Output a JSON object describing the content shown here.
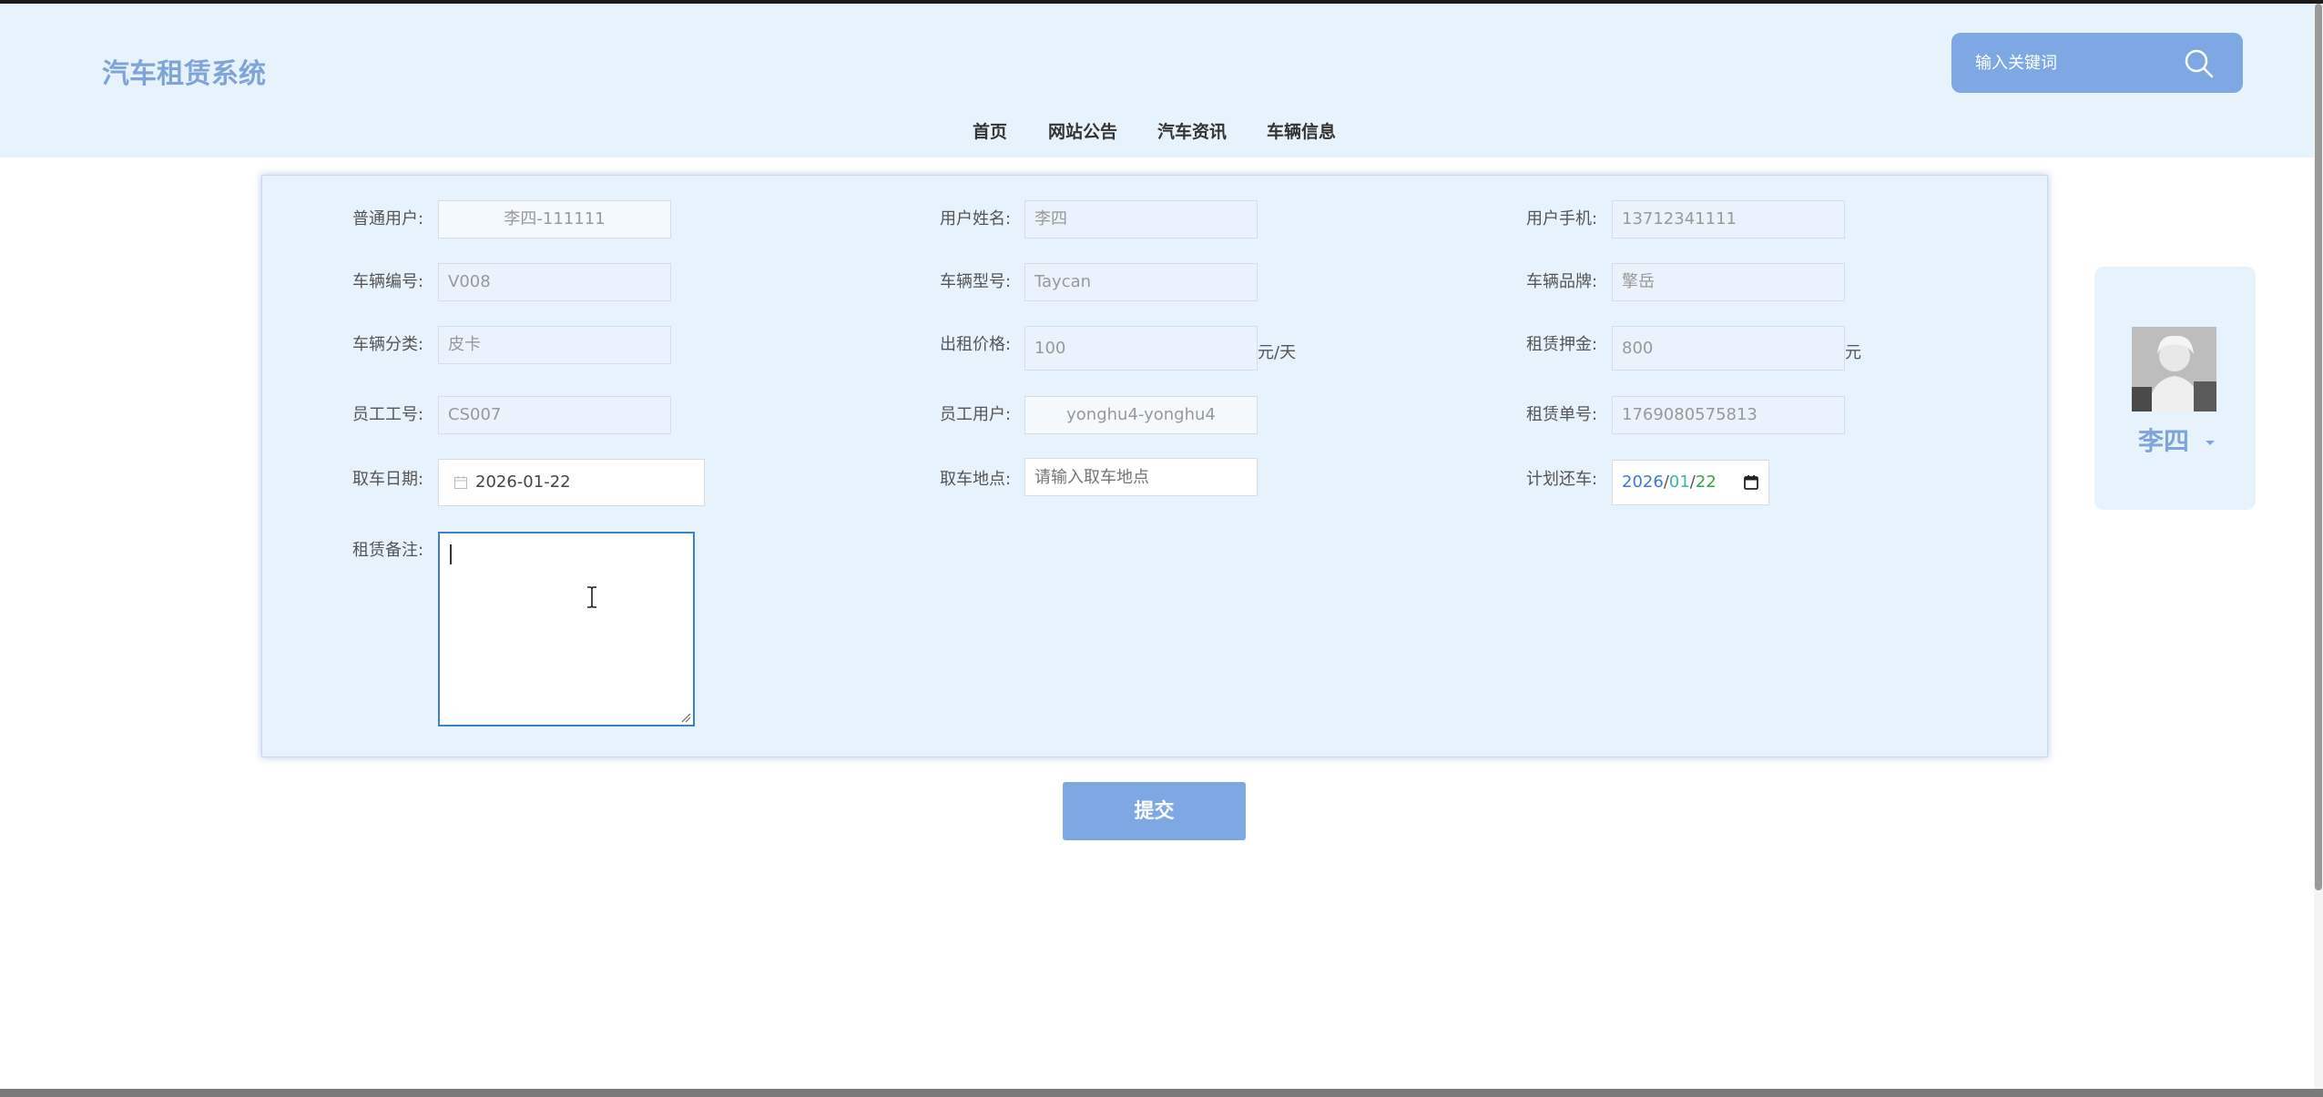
{
  "header": {
    "title": "汽车租赁系统",
    "search_placeholder": "输入关键词",
    "nav": [
      "首页",
      "网站公告",
      "汽车资讯",
      "车辆信息"
    ]
  },
  "form": {
    "fields": {
      "ordinary_user": {
        "label": "普通用户:",
        "value": "李四-111111"
      },
      "user_name": {
        "label": "用户姓名:",
        "value": "李四"
      },
      "user_phone": {
        "label": "用户手机:",
        "value": "13712341111"
      },
      "vehicle_no": {
        "label": "车辆编号:",
        "value": "V008"
      },
      "vehicle_model": {
        "label": "车辆型号:",
        "value": "Taycan"
      },
      "vehicle_brand": {
        "label": "车辆品牌:",
        "value": "擎岳"
      },
      "vehicle_category": {
        "label": "车辆分类:",
        "value": "皮卡"
      },
      "rental_price": {
        "label": "出租价格:",
        "value": "100",
        "unit": "元/天"
      },
      "deposit": {
        "label": "租赁押金:",
        "value": "800",
        "unit": "元"
      },
      "staff_no": {
        "label": "员工工号:",
        "value": "CS007"
      },
      "staff_user": {
        "label": "员工用户:",
        "value": "yonghu4-yonghu4"
      },
      "order_no": {
        "label": "租赁单号:",
        "value": "1769080575813"
      },
      "pickup_date": {
        "label": "取车日期:",
        "value": "2026-01-22"
      },
      "pickup_location": {
        "label": "取车地点:",
        "placeholder": "请输入取车地点"
      },
      "planned_return": {
        "label": "计划还车:",
        "year": "2026",
        "month": "01",
        "day": "22",
        "sep": "/"
      },
      "remarks": {
        "label": "租赁备注:",
        "value": ""
      }
    },
    "submit_label": "提交"
  },
  "user_panel": {
    "name": "李四"
  }
}
